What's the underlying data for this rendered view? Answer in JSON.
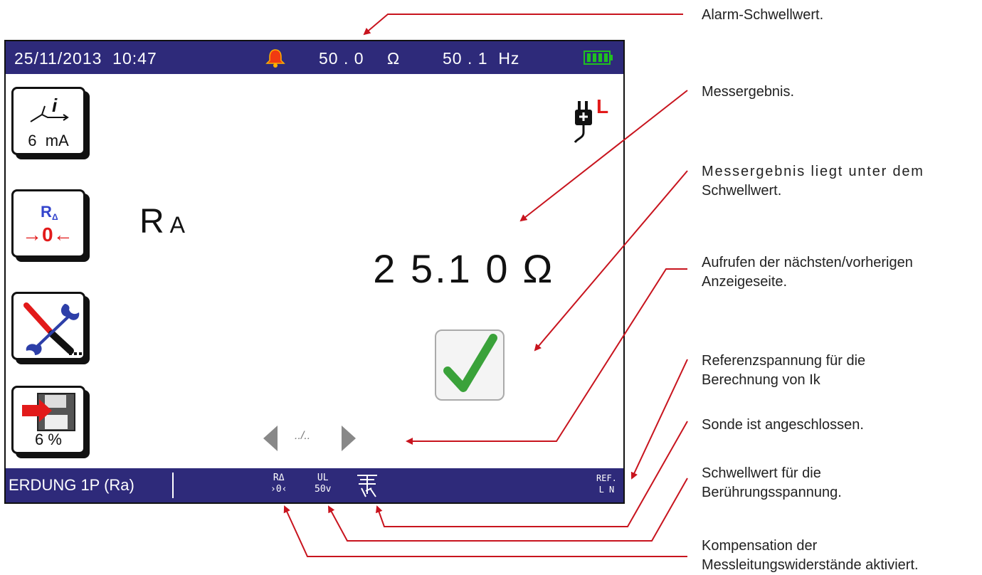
{
  "status_bar": {
    "datetime": "25/11/2013  10:47",
    "alarm_value": "50 . 0",
    "alarm_unit": "Ω",
    "frequency": "50 . 1  Hz"
  },
  "side_buttons": {
    "test_current": "6  mA",
    "memory": "6 %"
  },
  "measurement": {
    "label_main": "R",
    "label_sub": "A",
    "value": "2 5.1 0",
    "unit": "Ω"
  },
  "source_indicator": "L",
  "navigation": {
    "page_indicator": "../.."
  },
  "bottom_bar": {
    "mode": "ERDUNG 1P (Ra)",
    "compensation_top": "RΔ",
    "compensation_bottom": "›0‹",
    "touch_voltage_top": "UL",
    "touch_voltage_bottom": "50v",
    "reference_top": "REF.",
    "reference_bottom": "L N"
  },
  "callouts": [
    {
      "lines": [
        "Alarm-Schwellwert."
      ]
    },
    {
      "lines": [
        "Messergebnis."
      ]
    },
    {
      "lines": [
        "Messergebnis liegt unter dem",
        "Schwellwert."
      ]
    },
    {
      "lines": [
        "Aufrufen der nächsten/vorherigen",
        "Anzeigeseite."
      ]
    },
    {
      "lines": [
        "Referenzspannung für die",
        "Berechnung von Ik"
      ]
    },
    {
      "lines": [
        "Sonde ist angeschlossen."
      ]
    },
    {
      "lines": [
        "Schwellwert für die",
        "Berührungsspannung."
      ]
    },
    {
      "lines": [
        "Kompensation der",
        "Messleitungswiderstände aktiviert."
      ]
    }
  ],
  "colors": {
    "bar_background": "#2e2a7a",
    "annotation_red": "#c8141e",
    "check_green": "#3aa23a",
    "battery_green": "#20c020"
  }
}
